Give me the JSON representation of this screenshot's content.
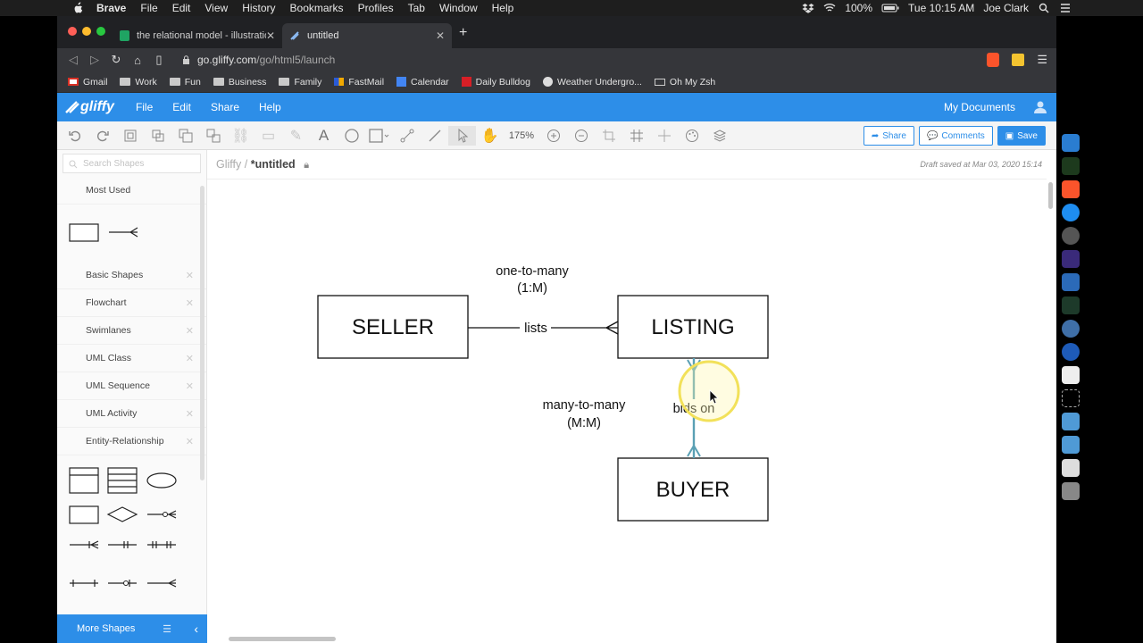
{
  "menubar": {
    "app": "Brave",
    "items": [
      "File",
      "Edit",
      "View",
      "History",
      "Bookmarks",
      "Profiles",
      "Tab",
      "Window",
      "Help"
    ],
    "battery": "100%",
    "clock": "Tue 10:15 AM",
    "user": "Joe Clark"
  },
  "browser": {
    "tabs": [
      {
        "title": "the relational model - illustrations"
      },
      {
        "title": "untitled"
      }
    ],
    "url_host": "go.gliffy.com",
    "url_path": "/go/html5/launch",
    "bookmarks": [
      "Gmail",
      "Work",
      "Fun",
      "Business",
      "Family",
      "FastMail",
      "Calendar",
      "Daily Bulldog",
      "Weather Undergro...",
      "Oh My Zsh"
    ]
  },
  "gliffy": {
    "logo": "gliffy",
    "menu": [
      "File",
      "Edit",
      "Share",
      "Help"
    ],
    "my_documents": "My Documents",
    "zoom": "175%",
    "share_label": "Share",
    "comments_label": "Comments",
    "save_label": "Save",
    "breadcrumb_root": "Gliffy",
    "breadcrumb_sep": "/",
    "doc_title": "*untitled",
    "draft_status": "Draft saved at Mar 03, 2020 15:14",
    "search_placeholder": "Search Shapes",
    "categories": [
      "Most Used",
      "Basic Shapes",
      "Flowchart",
      "Swimlanes",
      "UML Class",
      "UML Sequence",
      "UML Activity",
      "Entity-Relationship"
    ],
    "more_shapes": "More Shapes"
  },
  "diagram": {
    "entities": [
      "SELLER",
      "LISTING",
      "BUYER"
    ],
    "rel1_label": "lists",
    "rel1_caption_line1": "one-to-many",
    "rel1_caption_line2": "(1:M)",
    "rel2_label": "bids on",
    "rel2_caption_line1": "many-to-many",
    "rel2_caption_line2": "(M:M)"
  }
}
